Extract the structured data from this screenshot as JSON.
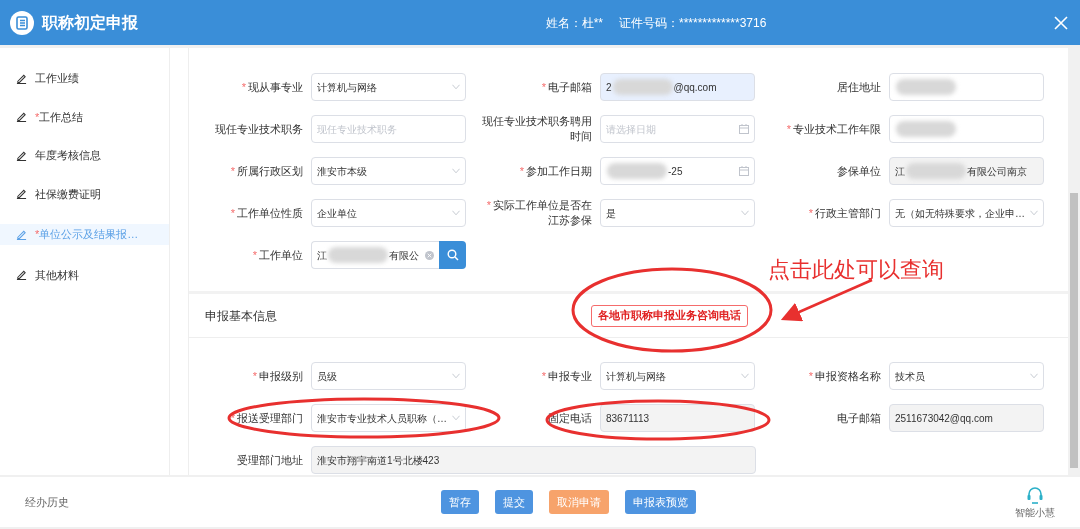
{
  "header": {
    "title": "职称初定申报",
    "name_label": "姓名：",
    "name": "杜**",
    "id_label": "证件号码：",
    "id_number": "*************3716"
  },
  "sidebar": {
    "items": [
      {
        "label": "工作业绩",
        "selected": false
      },
      {
        "label": "工作总结",
        "mark": "*",
        "selected": false
      },
      {
        "label": "年度考核信息",
        "selected": false
      },
      {
        "label": "社保缴费证明",
        "selected": false
      },
      {
        "label": "单位公示及结果报…",
        "mark": "*",
        "selected": true
      },
      {
        "label": "其他材料",
        "selected": false
      }
    ]
  },
  "form_rows": [
    [
      {
        "label": "现从事专业",
        "mark": "*",
        "kind": "select",
        "value": "计算机与网络"
      },
      {
        "label": "电子邮箱",
        "mark": "*",
        "kind": "text",
        "autofilled": true,
        "value": "2",
        "redacted": true,
        "value_after": "@qq.com"
      },
      {
        "label": "居住地址",
        "kind": "text",
        "redacted": true
      }
    ],
    [
      {
        "label": "现任专业技术职务",
        "kind": "text",
        "placeholder": "现任专业技术职务"
      },
      {
        "label": "现任专业技术职务聘用时间",
        "kind": "date",
        "placeholder": "请选择日期"
      },
      {
        "label": "专业技术工作年限",
        "mark": "*",
        "kind": "text",
        "redacted": true
      }
    ],
    [
      {
        "label": "所属行政区划",
        "mark": "*",
        "kind": "select",
        "value": "淮安市本级"
      },
      {
        "label": "参加工作日期",
        "mark": "*",
        "kind": "date",
        "redacted": true,
        "value_after": "-25"
      },
      {
        "label": "参保单位",
        "kind": "text",
        "readonly": true,
        "value": "江",
        "redacted": true,
        "value_after": "有限公司南京"
      }
    ],
    [
      {
        "label": "工作单位性质",
        "mark": "*",
        "kind": "select",
        "value": "企业单位"
      },
      {
        "label": "实际工作单位是否在江苏参保",
        "mark": "*",
        "kind": "select",
        "value": "是"
      },
      {
        "label": "行政主管部门",
        "mark": "*",
        "kind": "select",
        "value": "无（如无特殊要求，企业申…"
      }
    ],
    [
      {
        "label": "工作单位",
        "mark": "*",
        "kind": "search",
        "value": "江",
        "redacted": true,
        "value_after": "有限公"
      },
      null,
      null
    ]
  ],
  "section": {
    "title": "申报基本信息",
    "consult_button": "各地市职称申报业务咨询电话",
    "rows": [
      [
        {
          "label": "申报级别",
          "mark": "*",
          "kind": "select",
          "value": "员级"
        },
        {
          "label": "申报专业",
          "mark": "*",
          "kind": "select",
          "value": "计算机与网络"
        },
        {
          "label": "申报资格名称",
          "mark": "*",
          "kind": "select",
          "value": "技术员"
        }
      ],
      [
        {
          "label": "报送受理部门",
          "mark": "*",
          "kind": "select",
          "value": "淮安市专业技术人员职称（…"
        },
        {
          "label": "固定电话",
          "kind": "text",
          "readonly": true,
          "value": "83671113"
        },
        {
          "label": "电子邮箱",
          "kind": "text",
          "readonly": true,
          "value": "2511673042@qq.com"
        }
      ],
      [
        {
          "label": "受理部门地址",
          "kind": "wide",
          "readonly": true,
          "value": "淮安市翔宇南道1号北楼423"
        },
        null,
        null
      ]
    ]
  },
  "annotation": {
    "text": "点击此处可以查询"
  },
  "footer": {
    "history": "经办历史",
    "buttons": [
      {
        "label": "暂存",
        "kind": "primary"
      },
      {
        "label": "提交",
        "kind": "primary"
      },
      {
        "label": "取消申请",
        "kind": "warning"
      },
      {
        "label": "申报表预览",
        "kind": "primary"
      }
    ],
    "assistant": "智能小慧"
  }
}
